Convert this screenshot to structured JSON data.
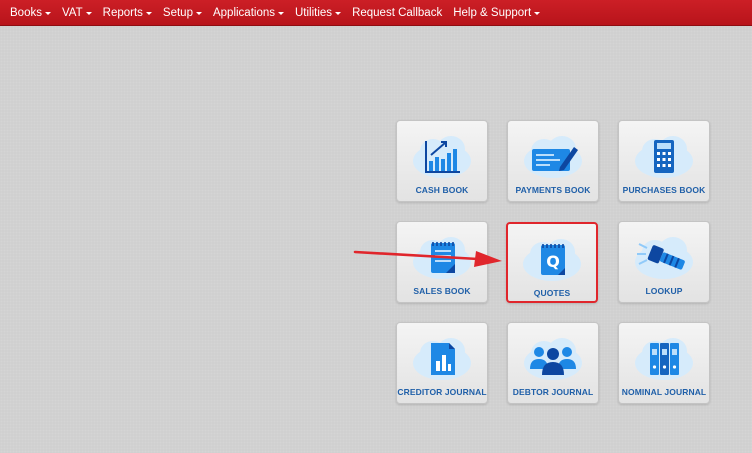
{
  "menu": [
    {
      "label": "Books",
      "dropdown": true
    },
    {
      "label": "VAT",
      "dropdown": true
    },
    {
      "label": "Reports",
      "dropdown": true
    },
    {
      "label": "Setup",
      "dropdown": true
    },
    {
      "label": "Applications",
      "dropdown": true
    },
    {
      "label": "Utilities",
      "dropdown": true
    },
    {
      "label": "Request Callback",
      "dropdown": false
    },
    {
      "label": "Help & Support",
      "dropdown": true
    }
  ],
  "tiles": [
    {
      "label": "CASH BOOK",
      "icon": "chart-growth-icon"
    },
    {
      "label": "PAYMENTS BOOK",
      "icon": "cheque-pen-icon"
    },
    {
      "label": "PURCHASES BOOK",
      "icon": "calculator-icon"
    },
    {
      "label": "SALES BOOK",
      "icon": "notepad-icon"
    },
    {
      "label": "QUOTES",
      "icon": "quote-notepad-icon",
      "selected": true
    },
    {
      "label": "LOOKUP",
      "icon": "flashlight-icon"
    },
    {
      "label": "CREDITOR JOURNAL",
      "icon": "document-chart-icon"
    },
    {
      "label": "DEBTOR JOURNAL",
      "icon": "people-group-icon"
    },
    {
      "label": "NOMINAL JOURNAL",
      "icon": "binders-icon"
    }
  ],
  "colors": {
    "navbar": "#c4181f",
    "tile_label": "#1f5fa8",
    "highlight": "#e0262c",
    "icon_blue": "#1e88e5"
  }
}
